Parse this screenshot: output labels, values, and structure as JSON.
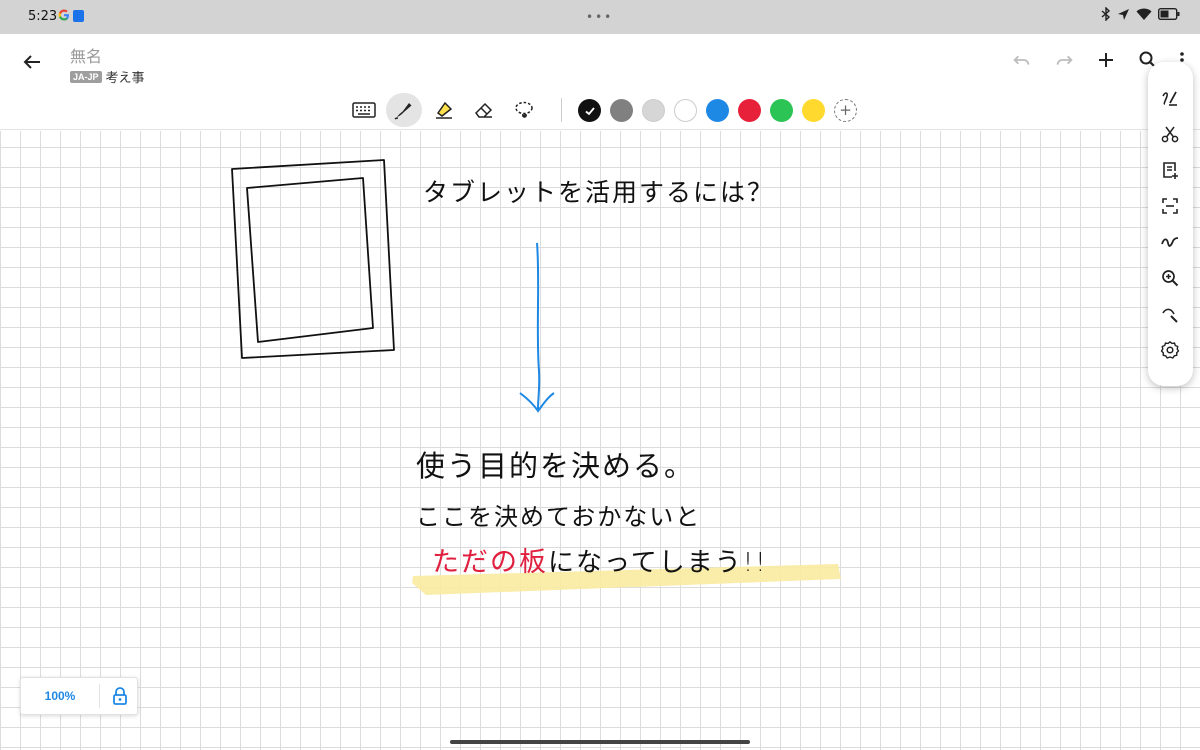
{
  "status": {
    "time": "5:23"
  },
  "header": {
    "title": "無名",
    "lang_badge": "JA-JP",
    "subtitle": "考え事"
  },
  "toolbar": {
    "tools": [
      "keyboard-icon",
      "pen-icon",
      "highlighter-icon",
      "eraser-icon",
      "lasso-icon"
    ],
    "active_tool": "pen",
    "colors": [
      "#111111",
      "#808080",
      "#d6d6d6",
      "#ffffff",
      "#1e88e5",
      "#e8213a",
      "#2bc455",
      "#ffd92e"
    ],
    "selected_color": "#111111"
  },
  "sidebar": {
    "items": [
      "write-icon",
      "scissors-icon",
      "note-add-icon",
      "scan-icon",
      "stroke-icon",
      "zoom-in-icon",
      "brush-icon",
      "settings-icon"
    ]
  },
  "canvas": {
    "text1": "タブレットを活用するには？",
    "text2": "使う目的を決める。",
    "text3": "ここを決めておかないと",
    "text4_red": "ただの板",
    "text4_black": "になってしまう!!",
    "highlight_color": "#faeaa0",
    "arrow_color": "#1e88e5"
  },
  "zoom": {
    "level": "100%"
  }
}
